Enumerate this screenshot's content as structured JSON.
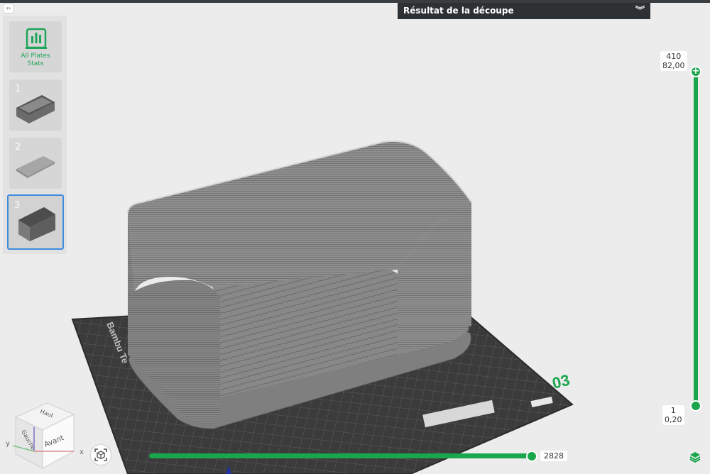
{
  "panel": {
    "title": "Résultat de la découpe",
    "collapse_icon": "double-chevron-down-icon"
  },
  "plates": {
    "stats": {
      "line1": "All Plates",
      "line2": "Stats",
      "icon": "bar-chart-icon"
    },
    "items": [
      {
        "number": "1",
        "selected": false
      },
      {
        "number": "2",
        "selected": false
      },
      {
        "number": "3",
        "selected": true
      }
    ]
  },
  "layer_slider": {
    "top_layer": "410",
    "top_height": "82,00",
    "bottom_layer": "1",
    "bottom_height": "0,20"
  },
  "move_slider": {
    "value": "2828"
  },
  "build_plate": {
    "brand_text": "Bambu Te",
    "plate_number": "03"
  },
  "view_cube": {
    "top_face": "Haut",
    "left_face": "Gauche",
    "front_face": "Avant",
    "axis_x": "x",
    "axis_y": "y"
  },
  "colors": {
    "accent": "#1aa64d",
    "selection": "#3d8bdf",
    "header_bg": "#2e3133"
  }
}
